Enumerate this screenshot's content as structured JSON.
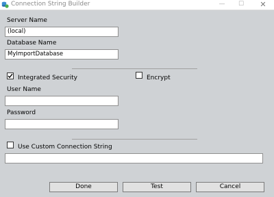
{
  "window": {
    "title": "Connection String Builder",
    "minimize_glyph": "—",
    "maximize_glyph": "☐",
    "close_glyph": "✕",
    "icon": "database-connection-icon"
  },
  "form": {
    "server_name_label": "Server Name",
    "server_name_value": "(local)",
    "database_name_label": "Database Name",
    "database_name_value": "MyImportDatabase",
    "integrated_security_label": "Integrated Security",
    "integrated_security_checked": true,
    "encrypt_label": "Encrypt",
    "encrypt_checked": false,
    "user_name_label": "User Name",
    "user_name_value": "",
    "password_label": "Password",
    "password_value": "",
    "use_custom_label": "Use Custom Connection String",
    "use_custom_checked": false,
    "custom_connection_value": ""
  },
  "buttons": {
    "done": "Done",
    "test": "Test",
    "cancel": "Cancel"
  }
}
